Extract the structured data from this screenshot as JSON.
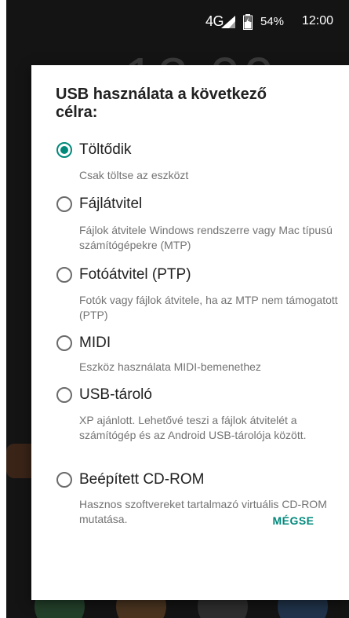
{
  "status_bar": {
    "network": "4G",
    "battery_percent": "54%",
    "time": "12:00"
  },
  "background": {
    "clock": "12:00"
  },
  "dialog": {
    "title": "USB használata a következő célra:",
    "options": [
      {
        "label": "Töltődik",
        "description": "Csak töltse az eszközt",
        "selected": true
      },
      {
        "label": "Fájlátvitel",
        "description": "Fájlok átvitele Windows rendszerre vagy Mac típusú számítógépekre (MTP)",
        "selected": false
      },
      {
        "label": "Fotóátvitel (PTP)",
        "description": "Fotók vagy fájlok átvitele, ha az MTP nem támogatott (PTP)",
        "selected": false
      },
      {
        "label": "MIDI",
        "description": "Eszköz használata MIDI-bemenethez",
        "selected": false
      },
      {
        "label": "USB-tároló",
        "description": "XP ajánlott. Lehetővé teszi a fájlok átvitelét a számítógép és az Android USB-tárolója között.",
        "selected": false
      },
      {
        "label": "Beépített CD-ROM",
        "description": "Hasznos szoftvereket tartalmazó virtuális CD-ROM mutatása.",
        "selected": false
      }
    ],
    "cancel_label": "MÉGSE"
  },
  "colors": {
    "accent": "#00897b",
    "screen_background": "#141414",
    "dialog_background": "#ffffff"
  }
}
